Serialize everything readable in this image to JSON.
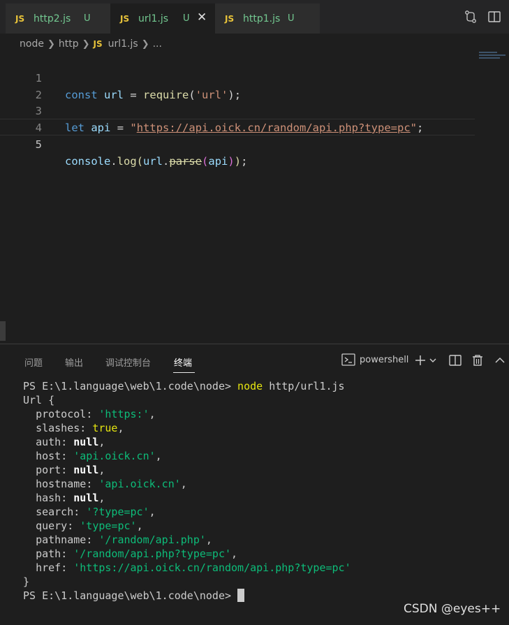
{
  "tabs": [
    {
      "icon": "JS",
      "name": "http2.js",
      "status": "U"
    },
    {
      "icon": "JS",
      "name": "url1.js",
      "status": "U",
      "close": "✕"
    },
    {
      "icon": "JS",
      "name": "http1.js",
      "status": "U"
    }
  ],
  "breadcrumb": {
    "folder1": "node",
    "folder2": "http",
    "file_icon": "JS",
    "file": "url1.js",
    "more": "..."
  },
  "editor": {
    "lines": [
      {
        "num": "1",
        "tokens": [
          "const",
          "url",
          "=",
          "require",
          "(",
          "'url'",
          ")",
          ";"
        ]
      },
      {
        "num": "2"
      },
      {
        "num": "3",
        "tokens": [
          "let",
          "api",
          "=",
          "\"",
          "https://api.oick.cn/random/api.php?type=pc",
          "\"",
          ";"
        ]
      },
      {
        "num": "4"
      },
      {
        "num": "5",
        "tokens": [
          "console",
          ".",
          "log",
          "(",
          "url",
          ".",
          "parse",
          "(",
          "api",
          ")",
          ")",
          ";"
        ]
      }
    ]
  },
  "panel": {
    "tabs": [
      "问题",
      "输出",
      "调试控制台",
      "终端"
    ],
    "active_tab": "终端",
    "shell": "powershell"
  },
  "terminal": {
    "prompt": "PS E:\\1.language\\web\\1.code\\node>",
    "command": "node",
    "command_arg": "http/url1.js",
    "object_open": "Url {",
    "fields": [
      {
        "key": "protocol",
        "value": "'https:'",
        "kind": "str"
      },
      {
        "key": "slashes",
        "value": "true",
        "kind": "bool"
      },
      {
        "key": "auth",
        "value": "null",
        "kind": "null"
      },
      {
        "key": "host",
        "value": "'api.oick.cn'",
        "kind": "str"
      },
      {
        "key": "port",
        "value": "null",
        "kind": "null"
      },
      {
        "key": "hostname",
        "value": "'api.oick.cn'",
        "kind": "str"
      },
      {
        "key": "hash",
        "value": "null",
        "kind": "null"
      },
      {
        "key": "search",
        "value": "'?type=pc'",
        "kind": "str"
      },
      {
        "key": "query",
        "value": "'type=pc'",
        "kind": "str"
      },
      {
        "key": "pathname",
        "value": "'/random/api.php'",
        "kind": "str"
      },
      {
        "key": "path",
        "value": "'/random/api.php?type=pc'",
        "kind": "str"
      },
      {
        "key": "href",
        "value": "'https://api.oick.cn/random/api.php?type=pc'",
        "kind": "str",
        "last": true
      }
    ],
    "object_close": "}",
    "final_prompt": "PS E:\\1.language\\web\\1.code\\node>"
  },
  "watermark": "CSDN @eyes++"
}
